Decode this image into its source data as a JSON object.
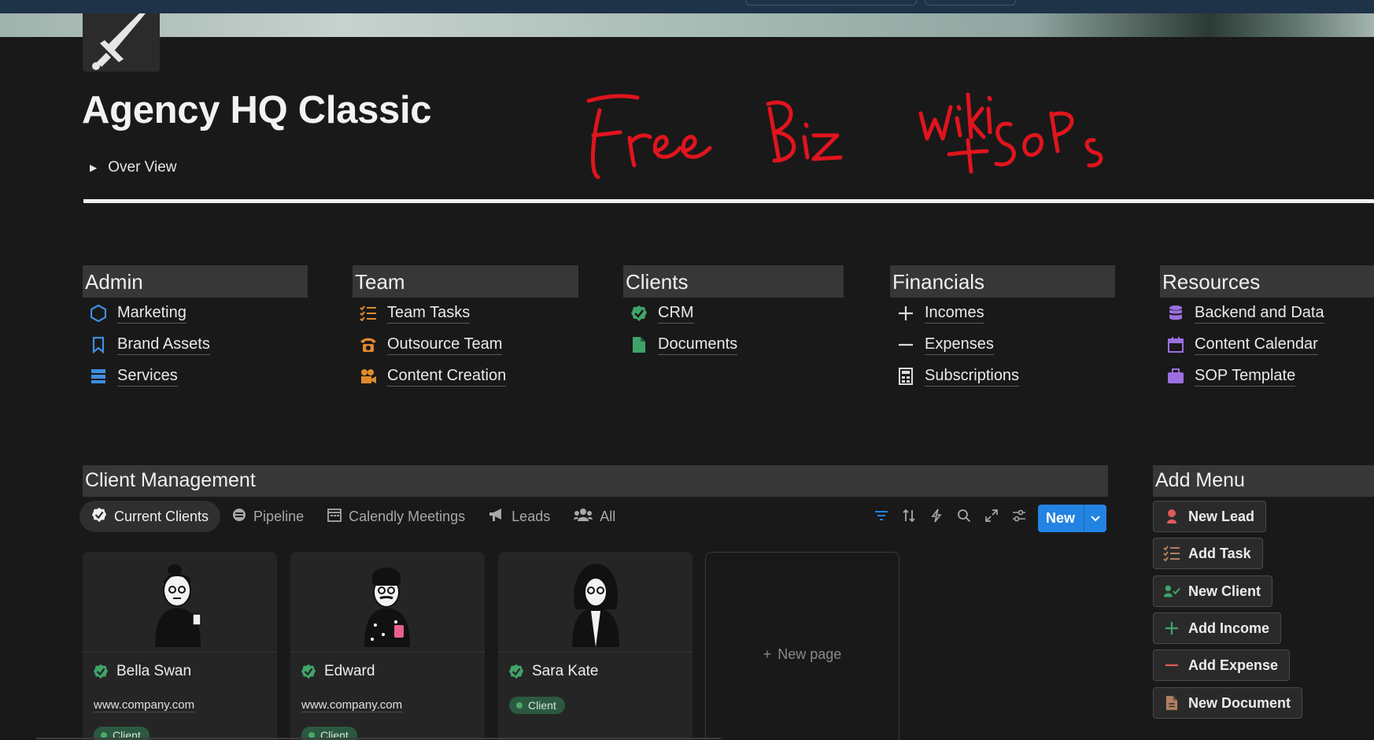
{
  "page": {
    "title": "Agency HQ Classic",
    "toggle_label": "Over View",
    "handwriting": [
      "Free",
      "Biz",
      "Wiki",
      "+ SOPs"
    ]
  },
  "categories": [
    {
      "title": "Admin",
      "items": [
        {
          "label": "Marketing",
          "icon": "hexagon-icon",
          "color": "#3f8fdf"
        },
        {
          "label": "Brand Assets",
          "icon": "bookmark-icon",
          "color": "#3f8fdf"
        },
        {
          "label": "Services",
          "icon": "server-icon",
          "color": "#3f8fdf"
        }
      ]
    },
    {
      "title": "Team",
      "items": [
        {
          "label": "Team Tasks",
          "icon": "checklist-icon",
          "color": "#e08a2d"
        },
        {
          "label": "Outsource Team",
          "icon": "phone-icon",
          "color": "#e08a2d"
        },
        {
          "label": "Content Creation",
          "icon": "video-camera-icon",
          "color": "#e08a2d"
        }
      ]
    },
    {
      "title": "Clients",
      "items": [
        {
          "label": "CRM",
          "icon": "verified-check-icon",
          "color": "#3fa46a"
        },
        {
          "label": "Documents",
          "icon": "document-icon",
          "color": "#3fa46a"
        }
      ]
    },
    {
      "title": "Financials",
      "items": [
        {
          "label": "Incomes",
          "icon": "plus-icon",
          "color": "#dcdcdc"
        },
        {
          "label": "Expenses",
          "icon": "minus-icon",
          "color": "#dcdcdc"
        },
        {
          "label": "Subscriptions",
          "icon": "calculator-icon",
          "color": "#dcdcdc"
        }
      ]
    },
    {
      "title": "Resources",
      "items": [
        {
          "label": "Backend and Data",
          "icon": "database-icon",
          "color": "#9b6fe0"
        },
        {
          "label": "Content Calendar",
          "icon": "calendar-icon",
          "color": "#9b6fe0"
        },
        {
          "label": "SOP Template",
          "icon": "briefcase-icon",
          "color": "#9b6fe0"
        }
      ]
    }
  ],
  "client_management": {
    "title": "Client Management",
    "tabs": [
      {
        "label": "Current Clients",
        "icon": "verified-check-icon",
        "active": true
      },
      {
        "label": "Pipeline",
        "icon": "pipeline-icon",
        "active": false
      },
      {
        "label": "Calendly Meetings",
        "icon": "calendar-icon",
        "active": false
      },
      {
        "label": "Leads",
        "icon": "megaphone-icon",
        "active": false
      },
      {
        "label": "All",
        "icon": "people-icon",
        "active": false
      }
    ],
    "toolbar": [
      "filter-icon",
      "sort-icon",
      "automation-bolt-icon",
      "search-icon",
      "expand-icon",
      "settings-sliders-icon"
    ],
    "new_label": "New",
    "cards": [
      {
        "name": "Bella Swan",
        "url": "www.company.com",
        "badge": "Client"
      },
      {
        "name": "Edward",
        "url": "www.company.com",
        "badge": "Client"
      },
      {
        "name": "Sara Kate",
        "url": "",
        "badge": "Client"
      }
    ],
    "new_page_label": "New page"
  },
  "add_menu": {
    "title": "Add Menu",
    "buttons": [
      {
        "label": "New Lead",
        "icon": "person-icon",
        "color": "#e05a5a"
      },
      {
        "label": "Add Task",
        "icon": "checklist-icon",
        "color": "#b08060"
      },
      {
        "label": "New Client",
        "icon": "person-check-icon",
        "color": "#3fa46a"
      },
      {
        "label": "Add Income",
        "icon": "plus-icon",
        "color": "#3fa46a"
      },
      {
        "label": "Add Expense",
        "icon": "minus-icon",
        "color": "#e05a5a"
      },
      {
        "label": "New Document",
        "icon": "document-icon",
        "color": "#b08060"
      }
    ]
  },
  "colors": {
    "accent": "#2383e2",
    "background": "#191919",
    "handwriting": "#e0141e"
  }
}
